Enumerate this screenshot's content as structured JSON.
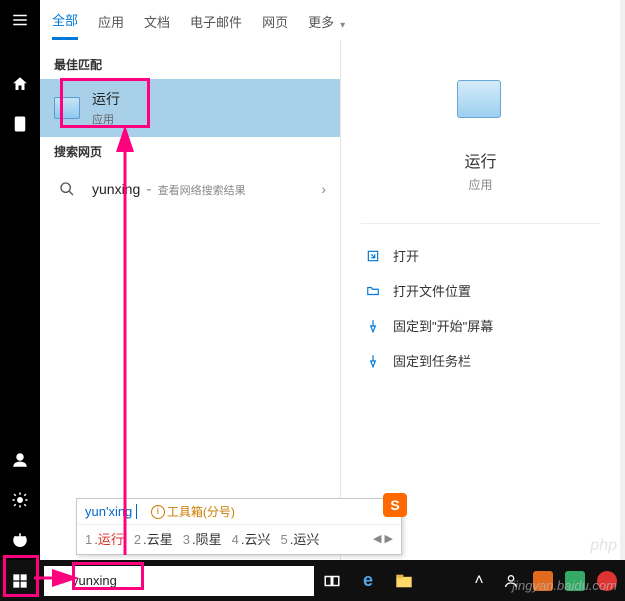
{
  "tabs": {
    "all": "全部",
    "apps": "应用",
    "docs": "文档",
    "mail": "电子邮件",
    "web": "网页",
    "more": "更多"
  },
  "sections": {
    "best_match": "最佳匹配",
    "search_web": "搜索网页"
  },
  "best_match_item": {
    "title": "运行",
    "subtitle": "应用"
  },
  "web_item": {
    "query": "yunxing",
    "hint": "查看网络搜索结果"
  },
  "preview": {
    "title": "运行",
    "subtitle": "应用"
  },
  "actions": {
    "open": "打开",
    "open_location": "打开文件位置",
    "pin_start": "固定到\"开始\"屏幕",
    "pin_taskbar": "固定到任务栏"
  },
  "ime": {
    "pinyin": "yun'xing",
    "tool": "工具箱(分号)",
    "candidates": [
      {
        "n": "1",
        "t": "运行"
      },
      {
        "n": "2",
        "t": "云星"
      },
      {
        "n": "3",
        "t": "陨星"
      },
      {
        "n": "4",
        "t": "云兴"
      },
      {
        "n": "5",
        "t": "运兴"
      }
    ]
  },
  "search_text": "yunxing",
  "watermark": "php",
  "watermark2": "jingyan.baidu.com"
}
